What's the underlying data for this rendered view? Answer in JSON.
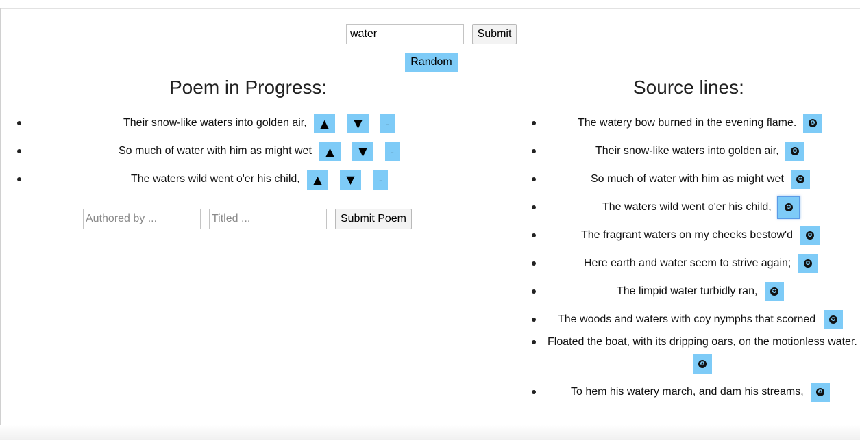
{
  "search": {
    "value": "water",
    "submit_label": "Submit",
    "random_label": "Random"
  },
  "poem": {
    "heading": "Poem in Progress:",
    "up_glyph": "▲",
    "down_glyph": "▼",
    "remove_glyph": "-",
    "lines": [
      "Their snow-like waters into golden air,",
      "So much of water with him as might wet",
      "The waters wild went o'er his child,"
    ],
    "author_placeholder": "Authored by ...",
    "title_placeholder": "Titled ...",
    "submit_label": "Submit Poem"
  },
  "source": {
    "heading": "Source lines:",
    "add_glyph": "✪",
    "lines": [
      "The watery bow burned in the evening flame.",
      "Their snow-like waters into golden air,",
      "So much of water with him as might wet",
      "The waters wild went o'er his child,",
      "The fragrant waters on my cheeks bestow'd",
      "Here earth and water seem to strive again;",
      "The limpid water turbidly ran,",
      "The woods and waters with coy nymphs that scorned",
      "Floated the boat, with its dripping oars, on the motionless water.",
      "To hem his watery march, and dam his streams,"
    ]
  },
  "colors": {
    "accent_blue": "#7ecbf7",
    "focus_ring": "#5a9be6"
  }
}
